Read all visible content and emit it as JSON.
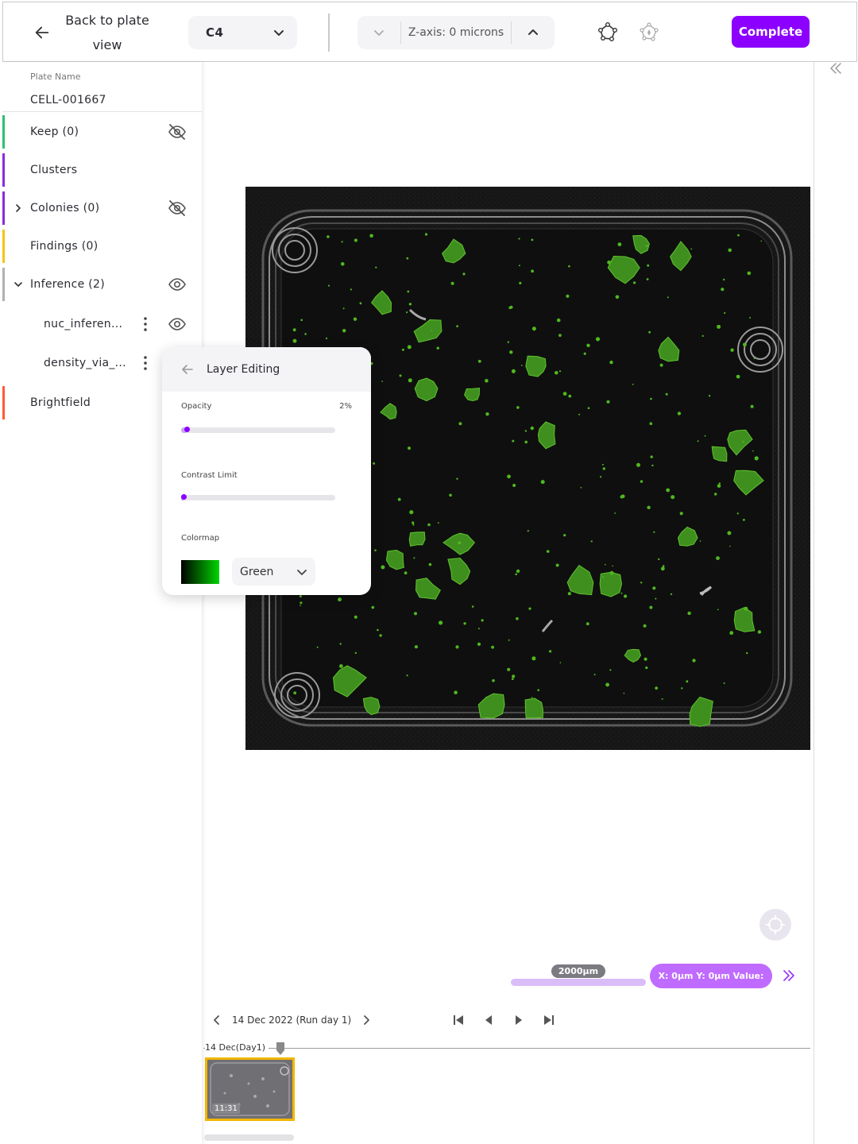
{
  "header": {
    "back_label": "Back to plate view",
    "well": "C4",
    "zaxis_label": "Z-axis: 0 microns",
    "complete_label": "Complete"
  },
  "sidebar": {
    "plate_name_label": "Plate Name",
    "plate_name": "CELL-001667",
    "layers": [
      {
        "label": "Keep (0)",
        "color": "#2fbf71",
        "visible": false
      },
      {
        "label": "Clusters",
        "color": "#8a2be2"
      },
      {
        "label": "Colonies (0)",
        "color": "#8a2be2",
        "visible": false
      },
      {
        "label": "Findings (0)",
        "color": "#f5c518"
      },
      {
        "label": "Inference (2)",
        "color": "#b0b0b5",
        "visible": true
      },
      {
        "label": "nuc_inferen...",
        "visible": true
      },
      {
        "label": "density_via_..."
      },
      {
        "label": "Brightfield",
        "color": "#ff5a36"
      }
    ]
  },
  "layer_editing": {
    "title": "Layer Editing",
    "opacity_label": "Opacity",
    "opacity_value": "2%",
    "opacity_level": 0.02,
    "contrast_label": "Contrast Limit",
    "contrast_level": 0.0,
    "colormap_label": "Colormap",
    "colormap_value": "Green"
  },
  "viewer": {
    "scale_label": "2000µm",
    "coord_label": "X: 0µm Y: 0µm Value:"
  },
  "timeline": {
    "date_label": "14 Dec 2022 (Run day 1)",
    "tick_label": "14 Dec(Day1)",
    "thumbnail_time": "11:31"
  },
  "colors": {
    "accent": "#8b00ff",
    "highlight": "#f2b600",
    "stain": "#4fb81f"
  }
}
